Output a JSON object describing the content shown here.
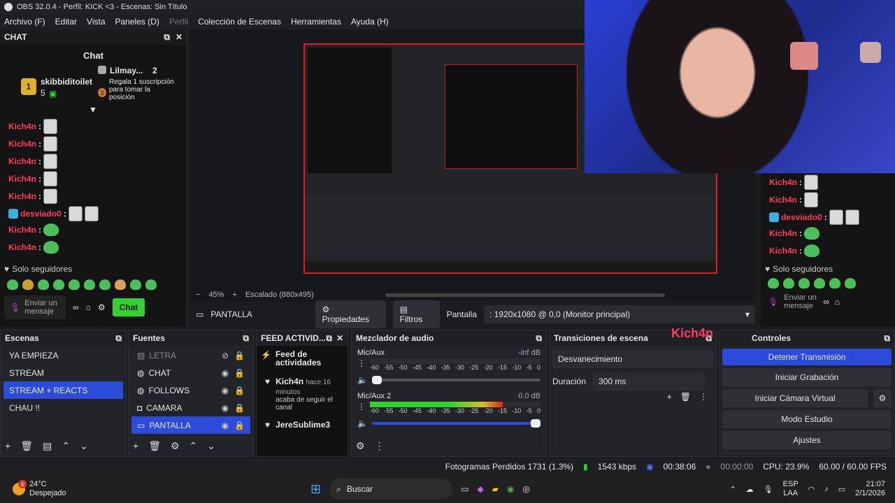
{
  "titlebar": {
    "title": "OBS 32.0.4 - Perfil: KICK <3 - Escenas: Sin Título"
  },
  "menu": [
    "Archivo (F)",
    "Editar",
    "Vista",
    "Paneles (D)",
    "Perfil",
    "Colección de Escenas",
    "Herramientas",
    "Ayuda (H)"
  ],
  "chat_dock": {
    "header": "CHAT",
    "title": "Chat",
    "pinned": {
      "user": "skibbiditoilet",
      "count": "5",
      "rank2_user": "Lilmay...",
      "rank2_count": "2",
      "rank3_text": "Regala 1 suscripción para tomar la posición",
      "rank1": "1",
      "rank3": "3"
    },
    "messages": [
      {
        "nick": "Kich4n",
        "type": "emote"
      },
      {
        "nick": "Kich4n",
        "type": "emote"
      },
      {
        "nick": "Kich4n",
        "type": "emote"
      },
      {
        "nick": "Kich4n",
        "type": "emote"
      },
      {
        "nick": "Kich4n",
        "type": "emote"
      },
      {
        "nick": "desviado0",
        "type": "emote"
      },
      {
        "nick": "Kich4n",
        "type": "pepe"
      },
      {
        "nick": "Kich4n",
        "type": "pepe"
      }
    ],
    "followers_only": "Solo seguidores",
    "input_placeholder": "Enviar un mensaje",
    "send_button": "Chat"
  },
  "preview": {
    "zoom": "45%",
    "scale": "Escalado (880x495)"
  },
  "source_toolbar": {
    "source_name": "PANTALLA",
    "properties": "Propiedades",
    "filters": "Filtros",
    "display_label": "Pantalla",
    "display_value": ": 1920x1080 @ 0,0 (Monitor principal)"
  },
  "right_chat": {
    "messages": [
      {
        "nick": "Kich4n",
        "type": "emote"
      },
      {
        "nick": "Kich4n",
        "type": "emote"
      },
      {
        "nick": "desviado0",
        "type": "emote"
      },
      {
        "nick": "Kich4n",
        "type": "pepe"
      },
      {
        "nick": "Kich4n",
        "type": "pepe"
      }
    ],
    "followers_only": "Solo seguidores",
    "input_placeholder": "Enviar un mensaje"
  },
  "scenes": {
    "header": "Escenas",
    "items": [
      "YA EMPIEZA",
      "STREAM",
      "STREAM + REACTS",
      "CHAU !!"
    ],
    "selected": 2
  },
  "sources": {
    "header": "Fuentes",
    "items": [
      {
        "label": "LETRA",
        "icon": "text-icon",
        "hidden": true
      },
      {
        "label": "CHAT",
        "icon": "browser-icon",
        "hidden": false
      },
      {
        "label": "FOLLOWS",
        "icon": "browser-icon",
        "hidden": false
      },
      {
        "label": "CAMARA",
        "icon": "camera-icon",
        "hidden": false
      },
      {
        "label": "PANTALLA",
        "icon": "display-icon",
        "hidden": false
      }
    ]
  },
  "feed": {
    "header": "FEED ACTIVID...",
    "title": "Feed de actividades",
    "entry1_user": "Kich4n",
    "entry1_time": "hace 16 minutos",
    "entry1_text": "acaba de seguir el canal",
    "entry2_user": "JereSublime3"
  },
  "mixer": {
    "header": "Mezclador de audio",
    "channels": [
      {
        "name": "Mic/Aux",
        "level": "-inf dB",
        "fill": 0.0
      },
      {
        "name": "Mic/Aux 2",
        "level": "0.0 dB",
        "fill": 0.78
      }
    ],
    "ticks": [
      "-60",
      "-55",
      "-50",
      "-45",
      "-40",
      "-35",
      "-30",
      "-25",
      "-20",
      "-15",
      "-10",
      "-5",
      "0"
    ]
  },
  "transitions": {
    "header": "Transiciones de escena",
    "transition": "Desvanecimiento",
    "duration_label": "Duración",
    "duration_value": "300 ms",
    "overlay_nick": "Kich4n"
  },
  "controls": {
    "header": "Controles",
    "stop_stream": "Detener Transmisión",
    "start_recording": "Iniciar Grabación",
    "virtual_cam": "Iniciar Cámara Virtual",
    "studio_mode": "Modo Estudio",
    "settings": "Ajustes"
  },
  "status": {
    "dropped": "Fotogramas Perdidos 1731 (1.3%)",
    "bitrate": "1543 kbps",
    "stream_time": "00:38:06",
    "rec_time": "00:00:00",
    "cpu": "CPU: 23.9%",
    "fps": "60.00 / 60.00 FPS"
  },
  "taskbar": {
    "temp": "24°C",
    "weather": "Despejado",
    "search": "Buscar",
    "lang": "ESP",
    "layout": "LAA",
    "time": "21:07",
    "date": "2/1/2026",
    "badge": "4"
  },
  "colors": {
    "accent": "#2c4bd8",
    "nick": "#ff3c5c",
    "chat_button": "#32d232",
    "webcam_bg": "#2a3fd6"
  }
}
